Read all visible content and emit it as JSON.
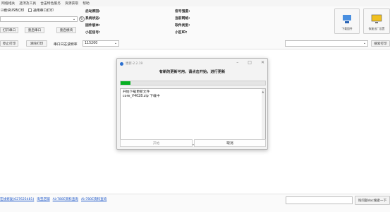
{
  "menu": [
    "网络相关",
    "选项及工具",
    "合宙特色服务",
    "资源获取",
    "帮助"
  ],
  "top": {
    "checkbox_usb": "☑模块USB打印",
    "checkbox_serial": "通用串口打印",
    "open_serial": "打开串口",
    "reset_serial": "重启串口",
    "reset_module": "重启模块",
    "stop_print": "停止打印",
    "clear_print": "清除打印",
    "baud_label": "串口日志波特率",
    "baud_value": "115200",
    "info_left": [
      {
        "label": "启动原因:",
        "value": ""
      },
      {
        "label": "系统状态:",
        "value": ""
      },
      {
        "label": "固件版本:",
        "value": ""
      },
      {
        "label": "小区信号:",
        "value": ""
      }
    ],
    "info_right": [
      {
        "label": "信号强度:",
        "value": ""
      },
      {
        "label": "当前网络:",
        "value": ""
      },
      {
        "label": "软件类型:",
        "value": ""
      },
      {
        "label": "小区ID:",
        "value": ""
      }
    ],
    "btn_download": "下载固件",
    "btn_restore": "恢复出厂设置",
    "search_button": "搜索打印"
  },
  "dialog": {
    "title": "更新-2.2.19",
    "header": "有新的更新可用，请点击开始，进行更新",
    "progress": 0.07,
    "log_lines": [
      "开始下载更新文件",
      "core_V4028.zip 下载中"
    ],
    "start_button": "开始",
    "cancel_button": "取消"
  },
  "bottom": {
    "links": [
      "在线修复(627625481)",
      "淘宝店铺",
      "Air780E资料查询",
      "Air780E资料查询"
    ],
    "search_button": "询问题doc搜索一下"
  },
  "colors": {
    "progress": "#08b023",
    "link": "#1a55c8"
  }
}
